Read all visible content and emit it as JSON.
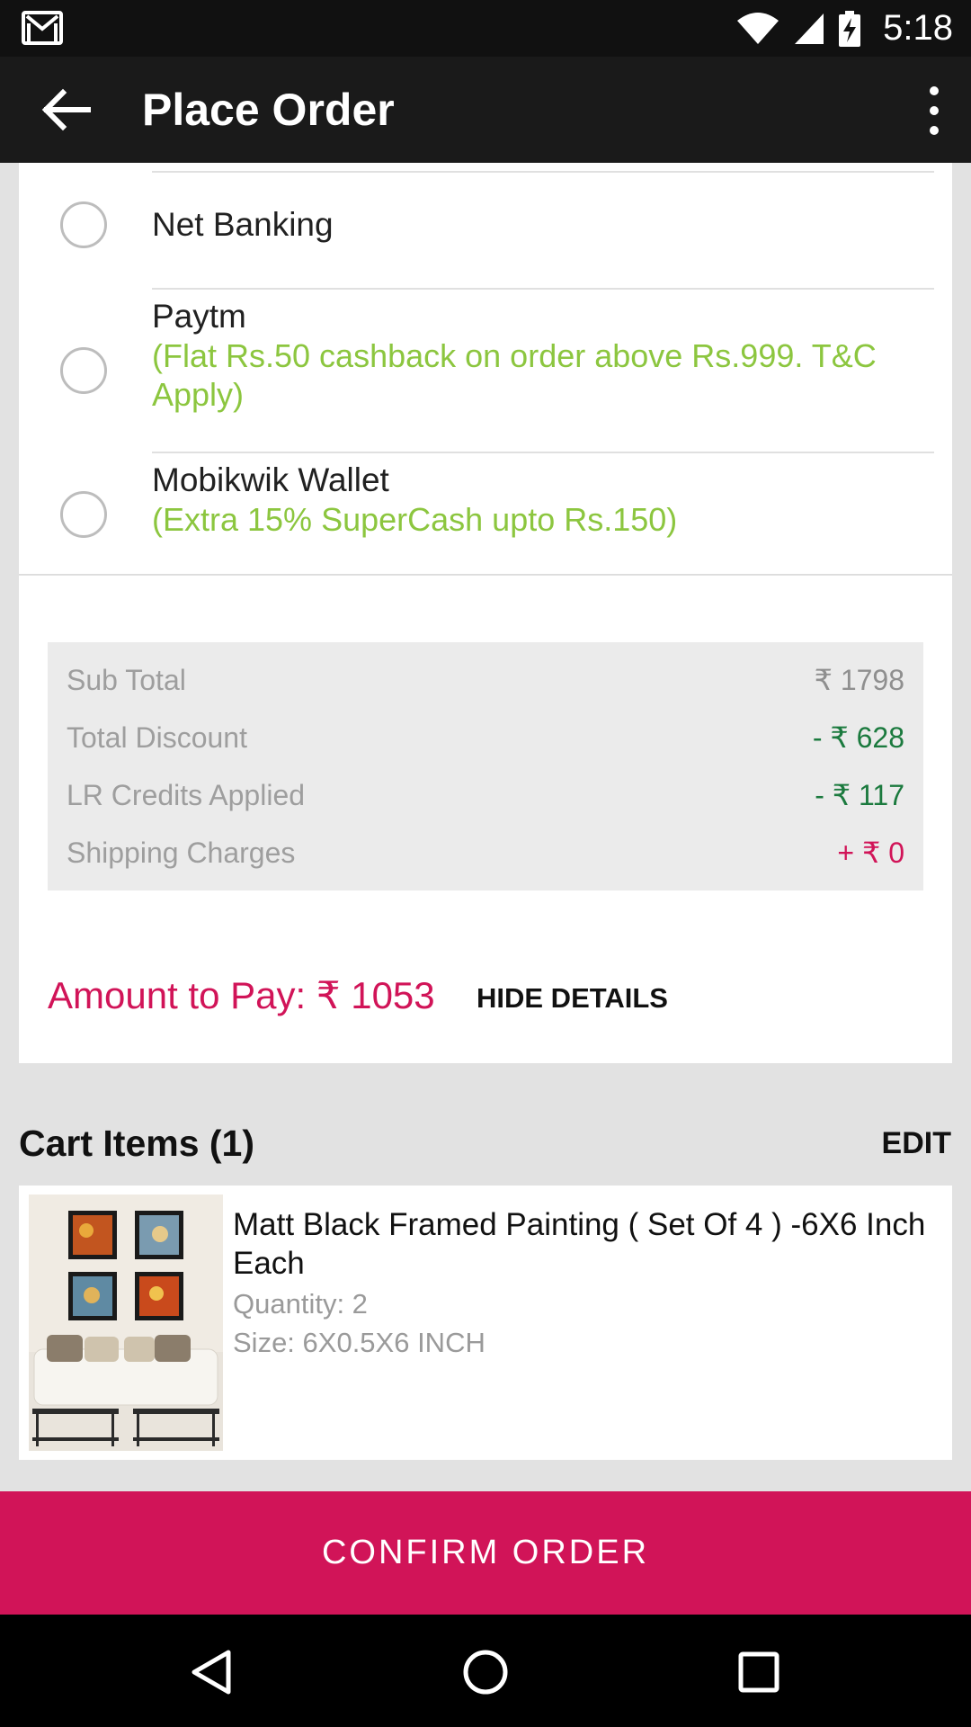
{
  "status_bar": {
    "time": "5:18",
    "icons": [
      "gmail-icon",
      "wifi-icon",
      "signal-icon",
      "battery-charging-icon"
    ]
  },
  "app_bar": {
    "title": "Place Order",
    "back_icon": "arrow-back-icon",
    "menu_icon": "more-vert-icon"
  },
  "payment_options": [
    {
      "name": "Net Banking",
      "offer": ""
    },
    {
      "name": "Paytm",
      "offer": "(Flat Rs.50 cashback on order above Rs.999. T&C Apply)"
    },
    {
      "name": "Mobikwik Wallet",
      "offer": "(Extra 15% SuperCash upto Rs.150)"
    }
  ],
  "summary": {
    "sub_total_label": "Sub Total",
    "sub_total_value": "₹ 1798",
    "discount_label": "Total Discount",
    "discount_value": "- ₹ 628",
    "credits_label": "LR Credits Applied",
    "credits_value": "- ₹ 117",
    "shipping_label": "Shipping Charges",
    "shipping_value": "+ ₹ 0"
  },
  "amount_to_pay": "Amount to Pay: ₹ 1053",
  "hide_details_label": "HIDE DETAILS",
  "cart": {
    "header": "Cart Items (1)",
    "edit_label": "EDIT",
    "items": [
      {
        "title": "Matt Black Framed Painting ( Set Of 4 ) -6X6 Inch Each",
        "quantity": "Quantity: 2",
        "size": "Size: 6X0.5X6 INCH"
      }
    ]
  },
  "confirm_label": "CONFIRM ORDER",
  "nav_bar": {
    "icons": [
      "back-triangle-icon",
      "home-circle-icon",
      "recents-square-icon"
    ]
  },
  "colors": {
    "accent": "#d11458",
    "offer_green": "#8cc63f",
    "discount_green": "#1b7a3e"
  }
}
